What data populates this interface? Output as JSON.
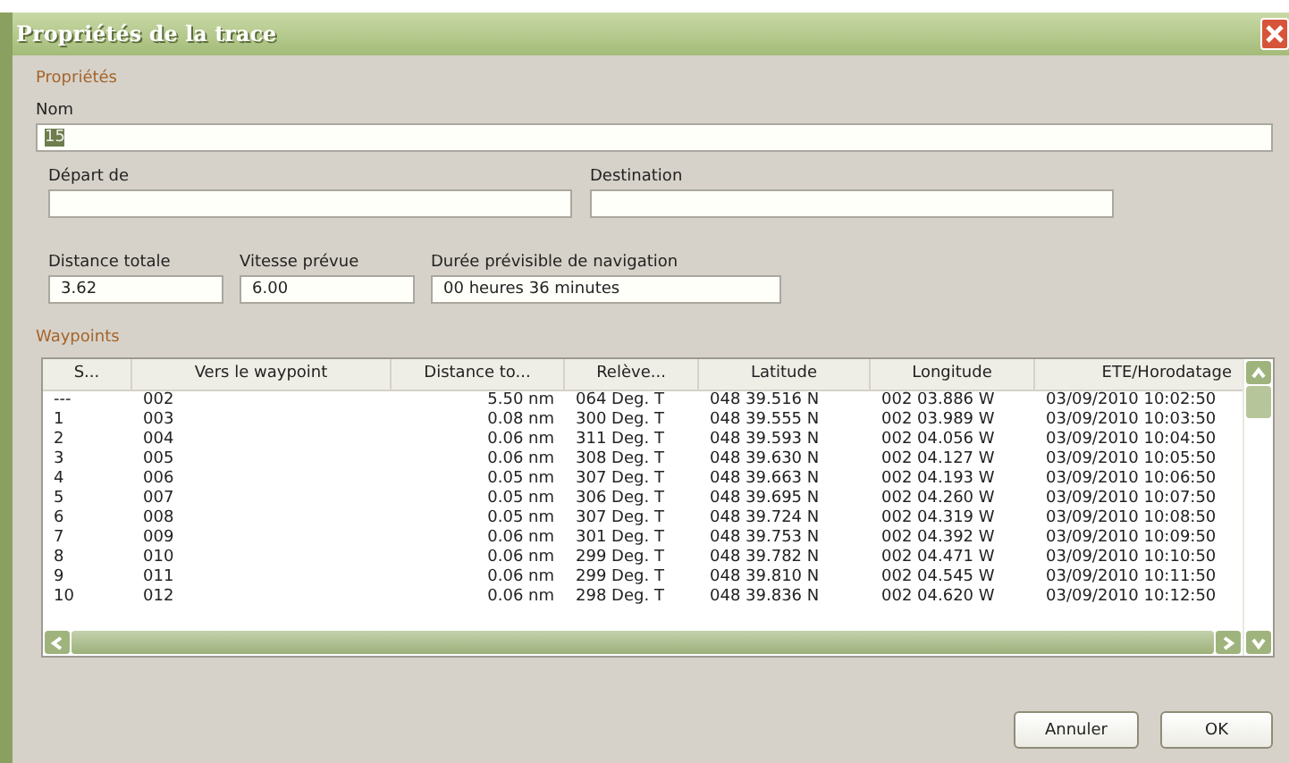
{
  "window": {
    "title": "Propriétés de la trace"
  },
  "properties": {
    "heading": "Propriétés",
    "name": {
      "label": "Nom",
      "value": "15"
    },
    "departure": {
      "label": "Départ de"
    },
    "destination": {
      "label": "Destination"
    },
    "total_distance": {
      "label": "Distance totale",
      "value": "3.62"
    },
    "planned_speed": {
      "label": "Vitesse prévue",
      "value": "6.00"
    },
    "duration": {
      "label": "Durée prévisible de navigation",
      "value": "00 heures  36 minutes"
    }
  },
  "waypoints": {
    "heading": "Waypoints",
    "columns": [
      "S...",
      "Vers le waypoint",
      "Distance to...",
      "Relève...",
      "Latitude",
      "Longitude",
      "ETE/Horodatage"
    ],
    "rows": [
      [
        "---",
        "002",
        "5.50 nm",
        "064 Deg. T",
        "048 39.516 N",
        "002 03.886 W",
        "03/09/2010 10:02:50"
      ],
      [
        "1",
        "003",
        "0.08 nm",
        "300 Deg. T",
        "048 39.555 N",
        "002 03.989 W",
        "03/09/2010 10:03:50"
      ],
      [
        "2",
        "004",
        "0.06 nm",
        "311 Deg. T",
        "048 39.593 N",
        "002 04.056 W",
        "03/09/2010 10:04:50"
      ],
      [
        "3",
        "005",
        "0.06 nm",
        "308 Deg. T",
        "048 39.630 N",
        "002 04.127 W",
        "03/09/2010 10:05:50"
      ],
      [
        "4",
        "006",
        "0.05 nm",
        "307 Deg. T",
        "048 39.663 N",
        "002 04.193 W",
        "03/09/2010 10:06:50"
      ],
      [
        "5",
        "007",
        "0.05 nm",
        "306 Deg. T",
        "048 39.695 N",
        "002 04.260 W",
        "03/09/2010 10:07:50"
      ],
      [
        "6",
        "008",
        "0.05 nm",
        "307 Deg. T",
        "048 39.724 N",
        "002 04.319 W",
        "03/09/2010 10:08:50"
      ],
      [
        "7",
        "009",
        "0.06 nm",
        "301 Deg. T",
        "048 39.753 N",
        "002 04.392 W",
        "03/09/2010 10:09:50"
      ],
      [
        "8",
        "010",
        "0.06 nm",
        "299 Deg. T",
        "048 39.782 N",
        "002 04.471 W",
        "03/09/2010 10:10:50"
      ],
      [
        "9",
        "011",
        "0.06 nm",
        "299 Deg. T",
        "048 39.810 N",
        "002 04.545 W",
        "03/09/2010 10:11:50"
      ],
      [
        "10",
        "012",
        "0.06 nm",
        "298 Deg. T",
        "048 39.836 N",
        "002 04.620 W",
        "03/09/2010 10:12:50"
      ]
    ]
  },
  "buttons": [
    "Annuler",
    "OK"
  ]
}
